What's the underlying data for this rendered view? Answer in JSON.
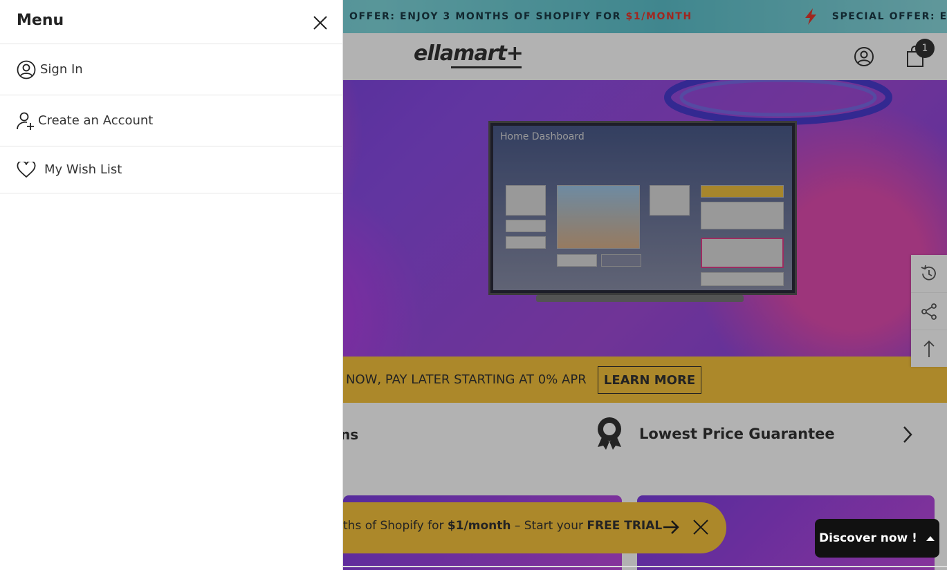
{
  "drawer": {
    "title": "Menu",
    "items": [
      {
        "label": "Sign In",
        "icon": "user-circle-icon"
      },
      {
        "label": "Create an Account",
        "icon": "user-plus-icon"
      },
      {
        "label": "My Wish List",
        "icon": "heart-icon"
      }
    ]
  },
  "announcement": {
    "text1_prefix": "OFFER: ENJOY 3 MONTHS OF SHOPIFY FOR ",
    "text1_price": "$1/MONTH",
    "text2": "SPECIAL OFFER: EN"
  },
  "header": {
    "logo": "ellamart+",
    "cart_count": "1"
  },
  "hero": {
    "tv_title": "Home Dashboard"
  },
  "promo": {
    "text": "NOW, PAY LATER STARTING AT 0% APR",
    "button": "LEARN MORE"
  },
  "features": {
    "partial": "ns",
    "title": "Lowest Price Guarantee"
  },
  "shopify_bar": {
    "prefix": "ths of Shopify for ",
    "price": "$1/month",
    "middle": " – Start your ",
    "trial": "FREE TRIAL"
  },
  "discover": {
    "label": "Discover now !"
  },
  "colors": {
    "announce_bg": "#5fc4cf",
    "promo_yellow": "#f6c33d",
    "price_red": "#e5372d",
    "text_dark": "#222222"
  }
}
